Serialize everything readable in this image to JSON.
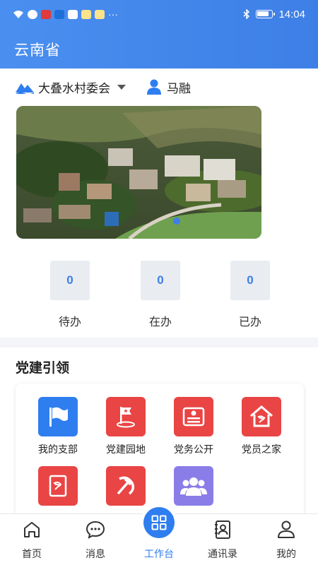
{
  "status": {
    "time": "14:04",
    "more": "···"
  },
  "header": {
    "title": "云南省"
  },
  "org": {
    "name": "大叠水村委会",
    "user": "马融"
  },
  "banner": {
    "active_index": 1
  },
  "stats": [
    {
      "value": "0",
      "label": "待办"
    },
    {
      "value": "0",
      "label": "在办"
    },
    {
      "value": "0",
      "label": "已办"
    }
  ],
  "party": {
    "title": "党建引领",
    "items": [
      {
        "label": "我的支部",
        "icon": "flag-icon",
        "color": "#2f7ef0"
      },
      {
        "label": "党建园地",
        "icon": "star-flag-icon",
        "color": "#e94545"
      },
      {
        "label": "党务公开",
        "icon": "document-icon",
        "color": "#e94545"
      },
      {
        "label": "党员之家",
        "icon": "home-icon",
        "color": "#e94545"
      },
      {
        "label": "",
        "icon": "notebook-icon",
        "color": "#e94545"
      },
      {
        "label": "",
        "icon": "hammer-sickle-icon",
        "color": "#e94545"
      },
      {
        "label": "",
        "icon": "people-icon",
        "color": "#8a7de8"
      }
    ]
  },
  "tabs": [
    {
      "label": "首页",
      "icon": "home-icon"
    },
    {
      "label": "消息",
      "icon": "chat-icon"
    },
    {
      "label": "工作台",
      "icon": "grid-icon",
      "active": true
    },
    {
      "label": "通讯录",
      "icon": "contacts-icon"
    },
    {
      "label": "我的",
      "icon": "user-icon"
    }
  ]
}
